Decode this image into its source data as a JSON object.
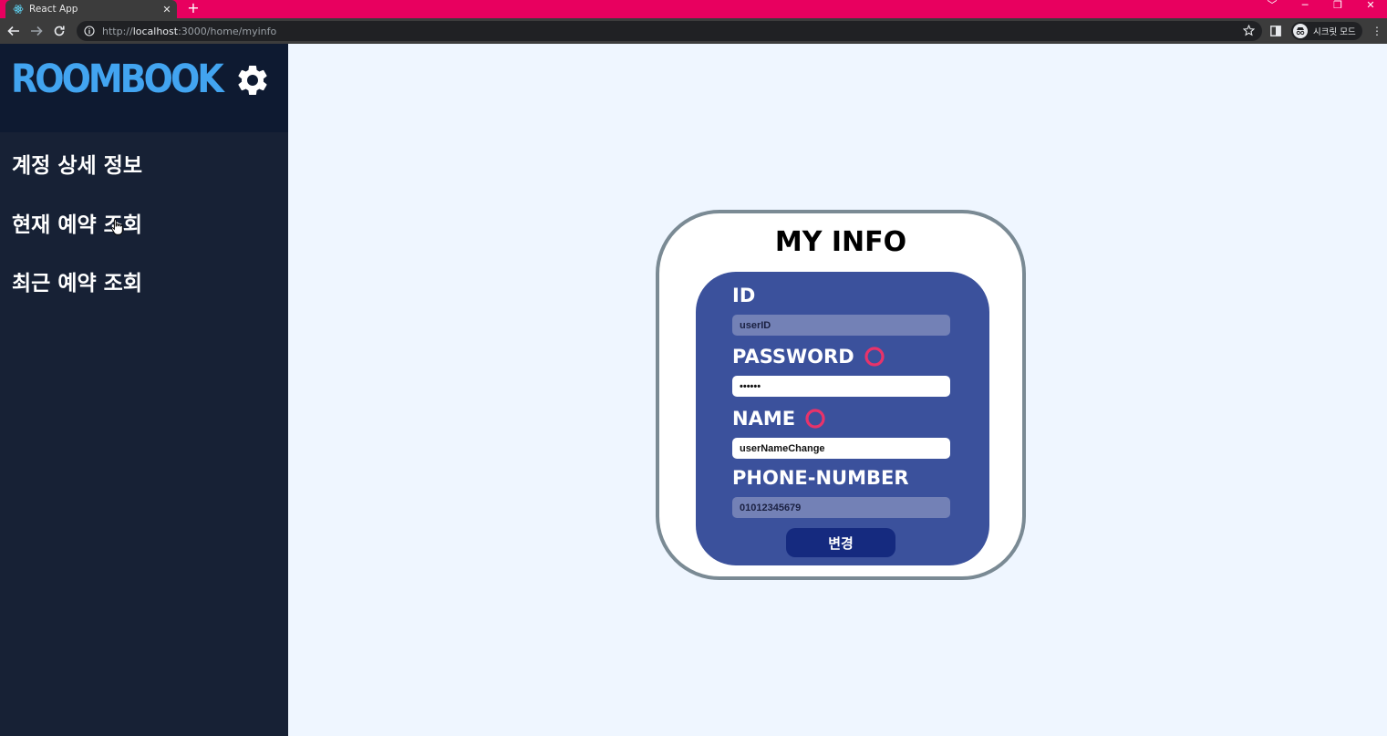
{
  "browser": {
    "tab_title": "React App",
    "tab_close": "✕",
    "new_tab": "+",
    "url_prefix": "http://",
    "url_host": "localhost",
    "url_path": ":3000/home/myinfo",
    "incognito_label": "시크릿 모드",
    "window_controls": [
      "﹀",
      "─",
      "❐",
      "✕"
    ]
  },
  "sidebar": {
    "logo": "ROOMBOOK",
    "items": [
      {
        "label": "계정 상세 정보"
      },
      {
        "label": "현재 예약 조회"
      },
      {
        "label": "최근 예약 조회"
      }
    ]
  },
  "myinfo": {
    "title": "MY INFO",
    "fields": [
      {
        "label": "ID",
        "value": "userID",
        "editable": false,
        "valid_mark": false
      },
      {
        "label": "PASSWORD",
        "value": "••••••",
        "editable": true,
        "valid_mark": true
      },
      {
        "label": "NAME",
        "value": "userNameChange",
        "editable": true,
        "valid_mark": true
      },
      {
        "label": "PHONE-NUMBER",
        "value": "01012345679",
        "editable": false,
        "valid_mark": false
      }
    ],
    "submit_label": "변경"
  },
  "colors": {
    "accent_tabbar": "#e8005f",
    "sidebar_bg": "#172135",
    "logo": "#42a4f0",
    "card_inner": "#3b519c",
    "submit": "#152a7f",
    "valid_ring": "#e8336a"
  }
}
